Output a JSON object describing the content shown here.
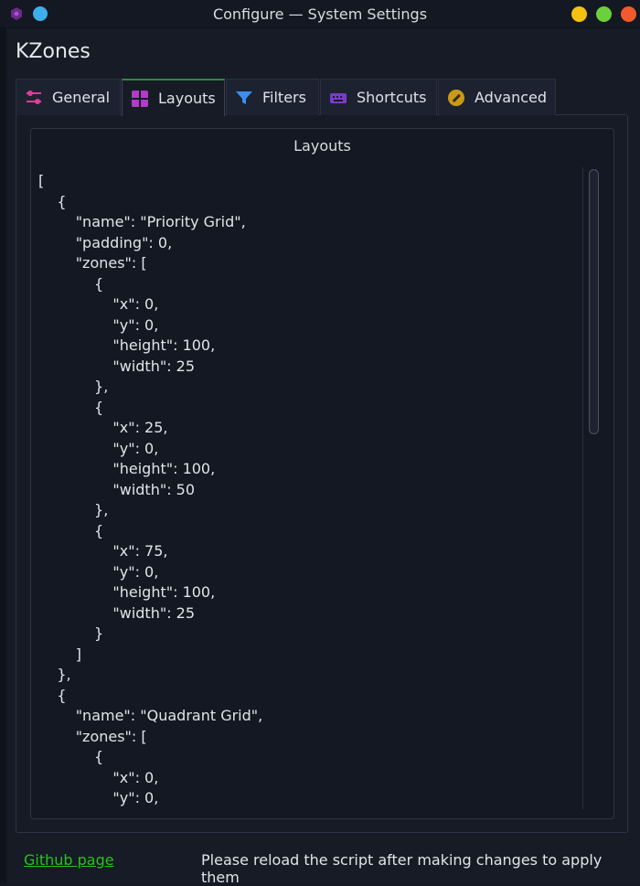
{
  "window": {
    "title": "Configure — System Settings"
  },
  "page": {
    "heading": "KZones"
  },
  "tabs": [
    {
      "label": "General",
      "icon": "sliders-icon",
      "active": false
    },
    {
      "label": "Layouts",
      "icon": "grid-icon",
      "active": true
    },
    {
      "label": "Filters",
      "icon": "funnel-icon",
      "active": false
    },
    {
      "label": "Shortcuts",
      "icon": "keyboard-icon",
      "active": false
    },
    {
      "label": "Advanced",
      "icon": "wrench-icon",
      "active": false
    }
  ],
  "layouts_group": {
    "title": "Layouts",
    "lines": [
      "[",
      "    {",
      "        \"name\": \"Priority Grid\",",
      "        \"padding\": 0,",
      "        \"zones\": [",
      "            {",
      "                \"x\": 0,",
      "                \"y\": 0,",
      "                \"height\": 100,",
      "                \"width\": 25",
      "            },",
      "            {",
      "                \"x\": 25,",
      "                \"y\": 0,",
      "                \"height\": 100,",
      "                \"width\": 50",
      "            },",
      "            {",
      "                \"x\": 75,",
      "                \"y\": 0,",
      "                \"height\": 100,",
      "                \"width\": 25",
      "            }",
      "        ]",
      "    },",
      "    {",
      "        \"name\": \"Quadrant Grid\",",
      "        \"zones\": [",
      "            {",
      "                \"x\": 0,",
      "                \"y\": 0,"
    ]
  },
  "footer": {
    "link_label": "Github page",
    "note": "Please reload the script after making changes to apply them"
  },
  "colors": {
    "link": "#27c21c",
    "active_tab_accent": "#2c8a3a",
    "minimize": "#f5c211",
    "maximize": "#6ccf3c",
    "close": "#f05a2c"
  }
}
